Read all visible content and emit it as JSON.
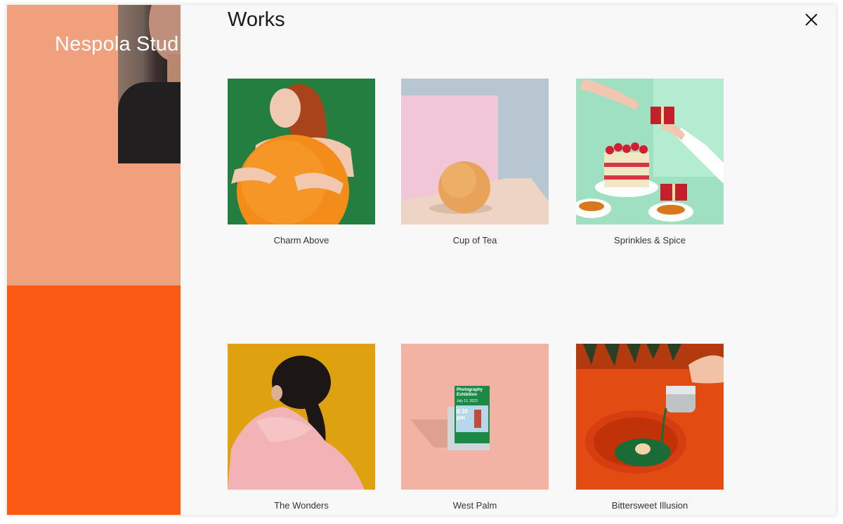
{
  "brand": {
    "name": "Nespola Stud"
  },
  "overlay": {
    "title": "Works",
    "close_icon": "close-icon"
  },
  "works": [
    {
      "title": "Charm Above"
    },
    {
      "title": "Cup of Tea"
    },
    {
      "title": "Sprinkles & Spice"
    },
    {
      "title": "The Wonders"
    },
    {
      "title": "West Palm"
    },
    {
      "title": "Bittersweet Illusion"
    }
  ],
  "poster": {
    "heading": "Photography Exhibition",
    "date": "July 12, 2023",
    "time": "8:30 pm"
  },
  "colors": {
    "peach": "#f0a07d",
    "orange": "#fa5a14",
    "panel_bg": "#f8f8f8"
  }
}
